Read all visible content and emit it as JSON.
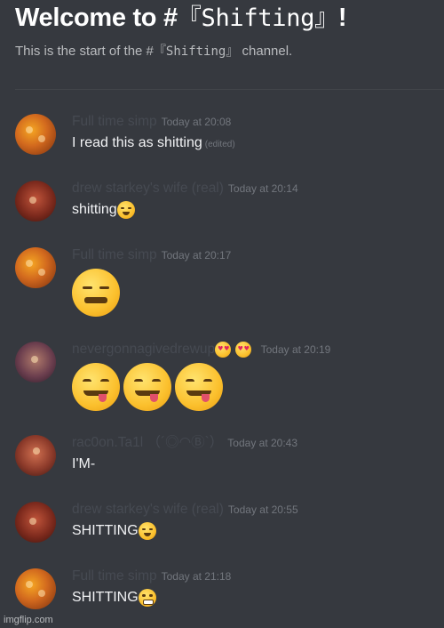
{
  "header": {
    "welcome_prefix": "Welcome to #",
    "channel_styled": "『Shifting』",
    "welcome_suffix": "!",
    "subtitle_prefix": "This is the start of the #",
    "subtitle_channel": "『Shifting』",
    "subtitle_suffix": " channel."
  },
  "messages": [
    {
      "username": "Full time simp",
      "timestamp": "Today at 20:08",
      "text": "I read this as shitting",
      "edited": "(edited)"
    },
    {
      "username": "drew starkey's wife (real)",
      "timestamp": "Today at 20:14",
      "text": "shitting",
      "emoji": "weary-face"
    },
    {
      "username": "Full time simp",
      "timestamp": "Today at 20:17",
      "emoji": "weary-face"
    },
    {
      "username": "nevergonnagivedrewup",
      "timestamp": "Today at 20:19",
      "emoji": "yum-face",
      "emoji_count": 3,
      "name_emoji": "heart-eyes-face"
    },
    {
      "username": "rac0on.Ta1l （´◎◠Ⓑ`）",
      "timestamp": "Today at 20:43",
      "text": "I'M-"
    },
    {
      "username": "drew starkey's wife (real)",
      "timestamp": "Today at 20:55",
      "text": "SHITTING",
      "emoji": "weary-face"
    },
    {
      "username": "Full time simp",
      "timestamp": "Today at 21:18",
      "text": "SHITTING",
      "emoji": "grimacing-face"
    }
  ],
  "footer": {
    "watermark": "imgflip.com"
  },
  "colors": {
    "background": "#36393f",
    "username": "#464a52",
    "timestamp": "#72767d",
    "text": "#f2f3f5"
  }
}
